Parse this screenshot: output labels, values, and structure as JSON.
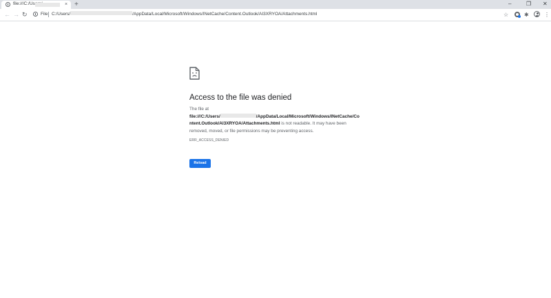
{
  "browser": {
    "tab": {
      "title": "file:///C:/Users/"
    },
    "new_tab_icon": "+",
    "close_tab_icon": "×",
    "window_controls": {
      "minimize": "–",
      "maximize": "❐",
      "close": "✕"
    },
    "toolbar": {
      "back_icon": "←",
      "forward_icon": "→",
      "reload_icon": "↻",
      "scheme_label": "File",
      "url_prefix": "C:/Users/",
      "url_suffix": "/AppData/Local/Microsoft/Windows/INetCache/Content.Outlook/AI3XRYOA/Attachments.html",
      "star_icon": "☆",
      "extensions_icon": "✱",
      "menu_icon": "⋮"
    }
  },
  "error": {
    "title": "Access to the file was denied",
    "desc_line1": "The file at",
    "path_part1": "file:///C:/Users/",
    "path_part2": "/AppData/Local/Microsoft/Windows/INetCache/Co",
    "path_part3": "ntent.Outlook/AI3XRYOA/Attachments.html",
    "desc_tail1": " is not readable. It may have been",
    "desc_line4": "removed, moved, or file permissions may be preventing access.",
    "code": "ERR_ACCESS_DENIED",
    "reload_label": "Reload"
  },
  "colors": {
    "accent": "#1a73e8",
    "tabstrip": "#dee1e6",
    "text": "#202124",
    "secondary_text": "#5f6368"
  }
}
